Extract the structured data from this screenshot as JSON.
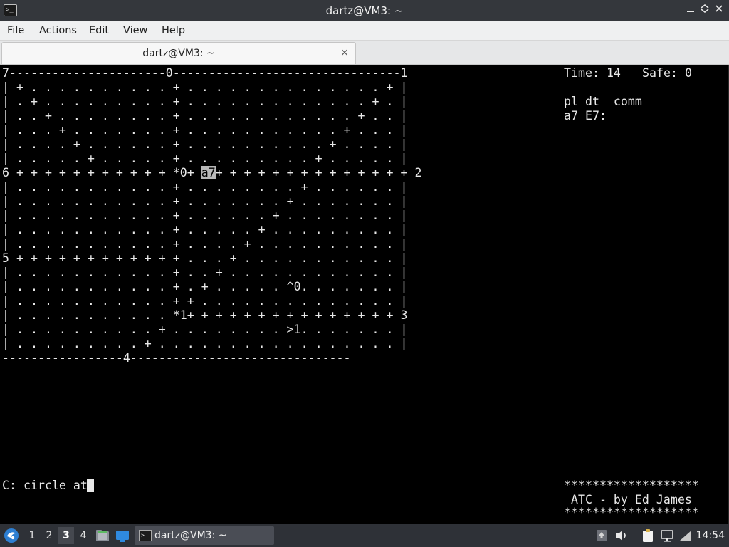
{
  "window": {
    "title": "dartz@VM3: ~",
    "app_icon": "terminal-icon",
    "controls": [
      "minimize-icon",
      "maximize-icon",
      "close-icon"
    ]
  },
  "menu": [
    "File",
    "Actions",
    "Edit",
    "View",
    "Help"
  ],
  "tab": {
    "label": "dartz@VM3: ~",
    "close_glyph": "×"
  },
  "game": {
    "grid_lines": [
      "7----------------------0--------------------------------1",
      "| + . . . . . . . . . . + . . . . . . . . . . . . . . + |",
      "| . + . . . . . . . . . + . . . . . . . . . . . . . + . |",
      "| . . + . . . . . . . . + . . . . . . . . . . . . + . . |",
      "| . . . + . . . . . . . + . . . . . . . . . . . + . . . |",
      "| . . . . + . . . . . . + . . . . . . . . . . + . . . . |",
      "| . . . . . + . . . . . + . . . . . . . . . + . . . . . |",
      null,
      "| . . . . . . . . . . . + . . . . . . . . + . . . . . . |",
      "| . . . . . . . . . . . + . . . . . . . + . . . . . . . |",
      "| . . . . . . . . . . . + . . . . . . + . . . . . . . . |",
      "| . . . . . . . . . . . + . . . . . + . . . . . . . . . |",
      "| . . . . . . . . . . . + . . . . + . . . . . . . . . . |",
      "5 + + + + + + + + + + + + . . . + . . . . . . . . . . . |",
      "| . . . . . . . . . . . + . . + . . . . . . . . . . . . |",
      "| . . . . . . . . . . . + . + . . . . . ^0. . . . . . . |",
      "| . . . . . . . . . . . + + . . . . . . . . . . . . . . |",
      "| . . . . . . . . . . . *1+ + + + + + + + + + + + + + + 3",
      "| . . . . . . . . . . + . . . . . . . . >1. . . . . . . |",
      "| . . . . . . . . . + . . . . . . . . . . . . . . . . . |",
      "------------------------------------------------------------4----------------------------------------------"
    ],
    "row6_before": "6 + + + + + + + + + + + *0+ ",
    "row6_plane": "a7",
    "row6_after": "+ + + + + + + + + + + + + + 2",
    "bottom_border": "-----------------4-------------------------------",
    "status": {
      "time_label": "Time: 14",
      "safe_label": "Safe: 0",
      "header": "pl dt  comm",
      "plane_line": "a7 E7:"
    },
    "command_line": "C: circle at",
    "credits_stars": "*******************",
    "credits": " ATC - by Ed James"
  },
  "taskbar": {
    "workspaces": [
      "1",
      "2",
      "3",
      "4"
    ],
    "active_workspace": "3",
    "task_label": "dartz@VM3: ~",
    "clock": "14:54",
    "tray_icons": [
      "updates-icon",
      "volume-icon",
      "clipboard-icon",
      "network-icon"
    ]
  }
}
